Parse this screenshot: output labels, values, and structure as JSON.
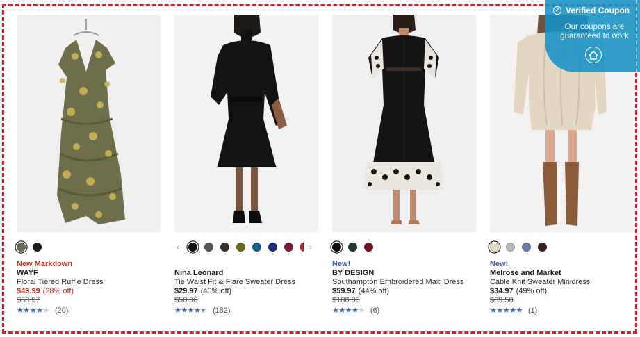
{
  "coupon": {
    "title": "Verified Coupon",
    "message": "Our coupons are guaranteed to work",
    "icons": [
      "check-circle-icon",
      "home-icon"
    ]
  },
  "products": [
    {
      "badge": "New Markdown",
      "brand": "WAYF",
      "title": "Floral Tiered Ruffle Dress",
      "price": "$49.99",
      "discount": "(28% off)",
      "was": "$68.97",
      "rating_stars": 4,
      "rating_count": "(20)",
      "swatches": [
        "#6a6d4f",
        "#1e1e1e"
      ],
      "selected_swatch": 0
    },
    {
      "badge": "",
      "brand": "Nina Leonard",
      "title": "Tie Waist Fit & Flare Sweater Dress",
      "price": "$29.97",
      "discount": "(40% off)",
      "was": "$50.00",
      "rating_stars": 4.5,
      "rating_count": "(182)",
      "swatches": [
        "#111111",
        "#555555",
        "#3b2e24",
        "#6b6a1f",
        "#1e5d86",
        "#1c2f7a",
        "#7a1b3f",
        "#c0252b"
      ],
      "selected_swatch": 0
    },
    {
      "badge": "New!",
      "brand": "BY DESIGN",
      "title": "Southampton Embroidered Maxi Dress",
      "price": "$59.97",
      "discount": "(44% off)",
      "was": "$108.00",
      "rating_stars": 4,
      "rating_count": "(6)",
      "swatches": [
        "#111111",
        "#1f3b2e",
        "#7a1420"
      ],
      "selected_swatch": 0
    },
    {
      "badge": "New!",
      "brand": "Melrose and Market",
      "title": "Cable Knit Sweater Minidress",
      "price": "$34.97",
      "discount": "(49% off)",
      "was": "$69.50",
      "rating_stars": 5,
      "rating_count": "(1)",
      "swatches": [
        "#e6dcc6",
        "#b8b8b8",
        "#6d7dab",
        "#3a1f1d"
      ],
      "selected_swatch": 0
    }
  ]
}
